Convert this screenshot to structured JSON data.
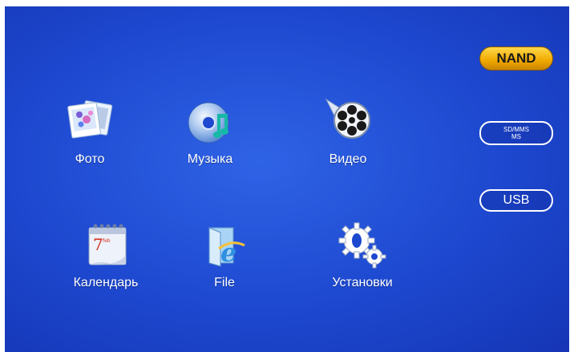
{
  "apps": [
    {
      "key": "photo",
      "label": "Фото",
      "icon": "photo-icon"
    },
    {
      "key": "music",
      "label": "Музыка",
      "icon": "music-cd-icon"
    },
    {
      "key": "video",
      "label": "Видео",
      "icon": "film-reel-icon"
    },
    {
      "key": "calendar",
      "label": "Календарь",
      "icon": "calendar-icon"
    },
    {
      "key": "file",
      "label": "File",
      "icon": "file-ie-icon"
    },
    {
      "key": "settings",
      "label": "Установки",
      "icon": "gears-icon"
    }
  ],
  "storage": {
    "nand": "NAND",
    "sd_line1": "SD/MMS",
    "sd_line2": "MS",
    "usb": "USB"
  },
  "calendar_icon": {
    "day": "7",
    "small": "feb"
  },
  "colors": {
    "background": "#1d48cf",
    "nand_badge": "#f0a800",
    "text": "#ffffff"
  }
}
